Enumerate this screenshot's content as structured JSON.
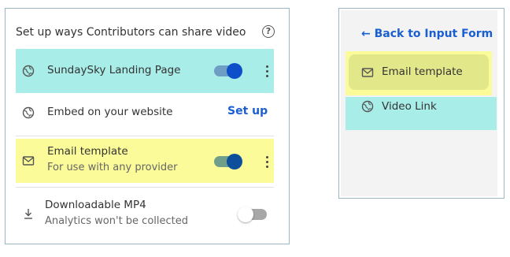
{
  "left_panel": {
    "header": "Set up ways Contributors can share video",
    "help_symbol": "?",
    "rows": [
      {
        "title": "SundaySky Landing Page",
        "subtitle": "",
        "icon": "globe-icon",
        "toggle": true,
        "highlight": "#a8ede8"
      },
      {
        "title": "Embed on your website",
        "subtitle": "",
        "icon": "globe-icon",
        "action": "Set up"
      },
      {
        "title": "Email template",
        "subtitle": "For use with any provider",
        "icon": "envelope-icon",
        "toggle": true,
        "highlight": "#fbfb9a"
      },
      {
        "title": "Downloadable MP4",
        "subtitle": "Analytics won't be collected",
        "icon": "download-icon",
        "toggle": false
      }
    ]
  },
  "right_panel": {
    "back_label": "Back to Input Form",
    "back_arrow": "←",
    "items": [
      {
        "label": "Email template",
        "icon": "envelope-icon",
        "selected": true
      },
      {
        "label": "Video Link",
        "icon": "globe-icon",
        "selected": false
      }
    ]
  },
  "colors": {
    "accent_blue": "#1a5fd1",
    "toggle_on_track": "#6f9ec5",
    "toggle_on_knob": "#0d4fc9",
    "toggle_off_track": "#a7a7a7",
    "cyan_highlight": "#a8ede8",
    "yellow_highlight": "#fbfb9a"
  }
}
